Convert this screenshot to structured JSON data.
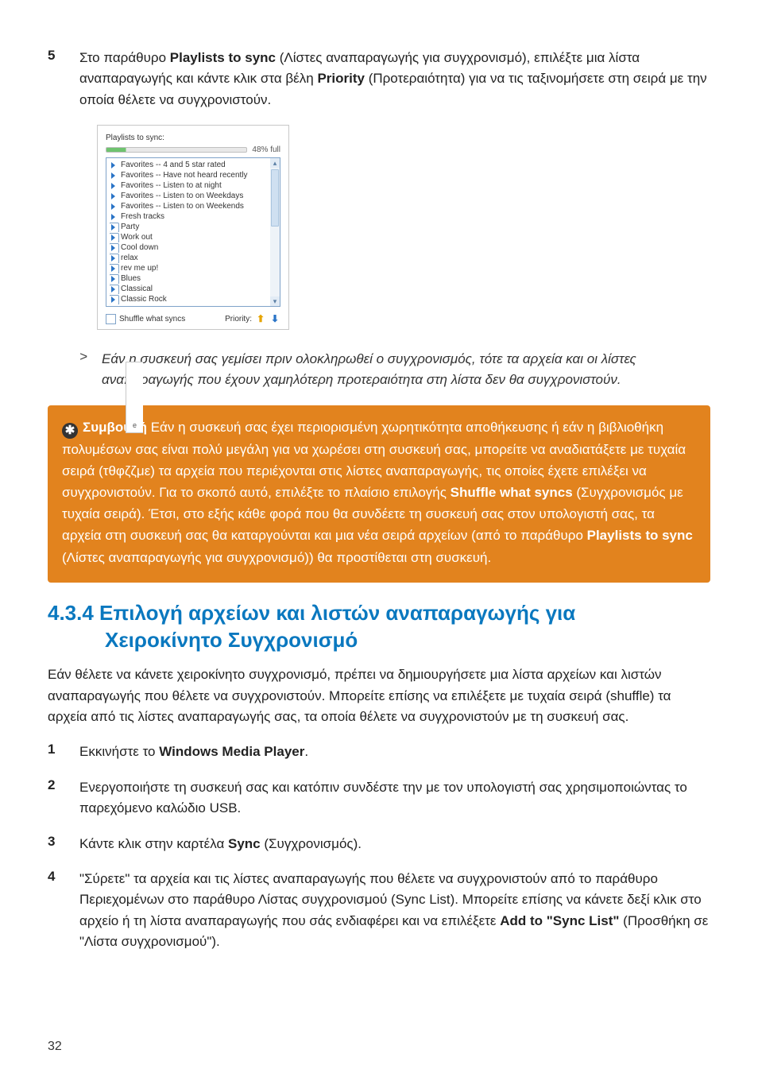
{
  "steps_top": {
    "num": "5",
    "body_pre": "Στο παράθυρο ",
    "bold1": "Playlists to sync",
    "body_mid": " (Λίστες αναπαραγωγής για συγχρονισμό), επιλέξτε μια λίστα αναπαραγωγής και κάντε κλικ στα βέλη ",
    "bold2": "Priority",
    "body_post": " (Προτεραιότητα) για να τις ταξινομήσετε στη σειρά με την οποία θέλετε να συγχρονιστούν."
  },
  "figure": {
    "title": "Playlists to sync:",
    "pct": "48% full",
    "items": [
      {
        "kind": "auto",
        "label": "Favorites -- 4 and 5 star rated"
      },
      {
        "kind": "auto",
        "label": "Favorites -- Have not heard recently"
      },
      {
        "kind": "auto",
        "label": "Favorites -- Listen to at night"
      },
      {
        "kind": "auto",
        "label": "Favorites -- Listen to on Weekdays"
      },
      {
        "kind": "auto",
        "label": "Favorites -- Listen to on Weekends"
      },
      {
        "kind": "auto",
        "label": "Fresh tracks"
      },
      {
        "kind": "user",
        "label": "Party"
      },
      {
        "kind": "user",
        "label": "Work out"
      },
      {
        "kind": "user",
        "label": "Cool down"
      },
      {
        "kind": "user",
        "label": "relax"
      },
      {
        "kind": "user",
        "label": "rev me up!"
      },
      {
        "kind": "user",
        "label": "Blues"
      },
      {
        "kind": "user",
        "label": "Classical"
      },
      {
        "kind": "user",
        "label": "Classic Rock"
      }
    ],
    "shuffle_label": "Shuffle what syncs",
    "priority_label": "Priority:",
    "overlay_tab": "e"
  },
  "note": {
    "gt": ">",
    "text": "Εάν η συσκευή σας γεμίσει πριν ολοκληρωθεί ο συγχρονισμός, τότε τα αρχεία και οι λίστες αναπαραγωγής που έχουν χαμηλότερη προτεραιότητα στη λίστα δεν θα συγχρονιστούν."
  },
  "tip": {
    "glyph": "✱",
    "label": "Συμβουλή",
    "t1": " Εάν η συσκευή σας έχει περιορισμένη χωρητικότητα αποθήκευσης ή εάν η βιβλιοθήκη πολυμέσων σας είναι πολύ μεγάλη για να χωρέσει στη συσκευή σας, μπορείτε να αναδιατάξετε με τυχαία σειρά (τθφζζμε) τα αρχεία που περιέχονται στις λίστες αναπαραγωγής, τις οποίες έχετε επιλέξει να συγχρονιστούν. Για το σκοπό αυτό, επιλέξτε το πλαίσιο επιλογής ",
    "b1": "Shuffle what syncs",
    "t2": " (Συγχρονισμός με τυχαία σειρά). Έτσι, στο εξής κάθε φορά που θα συνδέετε τη συσκευή σας στον υπολογιστή σας, τα αρχεία στη συσκευή σας θα καταργούνται και μια νέα σειρά αρχείων (από το παράθυρο ",
    "b2": "Playlists to sync",
    "t3": " (Λίστες αναπαραγωγής για συγχρονισμό)) θα προστίθεται στη συσκευή."
  },
  "section": {
    "num_title": "4.3.4 Επιλογή αρχείων και λιστών αναπαραγωγής για",
    "line2": "Χειροκίνητο Συγχρονισμό"
  },
  "intro": "Εάν θέλετε να κάνετε χειροκίνητο συγχρονισμό, πρέπει να δημιουργήσετε μια λίστα αρχείων και λιστών αναπαραγωγής που θέλετε να συγχρονιστούν. Μπορείτε επίσης να επιλέξετε με τυχαία σειρά (shuffle) τα αρχεία από τις λίστες αναπαραγωγής σας, τα οποία θέλετε να συγχρονιστούν με τη συσκευή σας.",
  "steps_bottom": [
    {
      "num": "1",
      "pre": "Εκκινήστε το ",
      "bold": "Windows Media Player",
      "post": "."
    },
    {
      "num": "2",
      "plain": "Ενεργοποιήστε τη συσκευή σας και κατόπιν συνδέστε την με τον υπολογιστή σας χρησιμοποιώντας το παρεχόμενο καλώδιο USB."
    },
    {
      "num": "3",
      "pre": "Κάντε κλικ στην καρτέλα ",
      "bold": "Sync",
      "post": " (Συγχρονισμός)."
    },
    {
      "num": "4",
      "pre": "\"Σύρετε\" τα αρχεία και τις λίστες αναπαραγωγής που θέλετε να συγχρονιστούν από το παράθυρο Περιεχομένων στο παράθυρο Λίστας συγχρονισμού (Sync List). Μπορείτε επίσης να κάνετε δεξί κλικ στο αρχείο ή τη λίστα αναπαραγωγής που σάς ενδιαφέρει και να επιλέξετε ",
      "bold": "Add to \"Sync List\"",
      "post": " (Προσθήκη σε \"Λίστα συγχρονισμού\")."
    }
  ],
  "page_number": "32"
}
